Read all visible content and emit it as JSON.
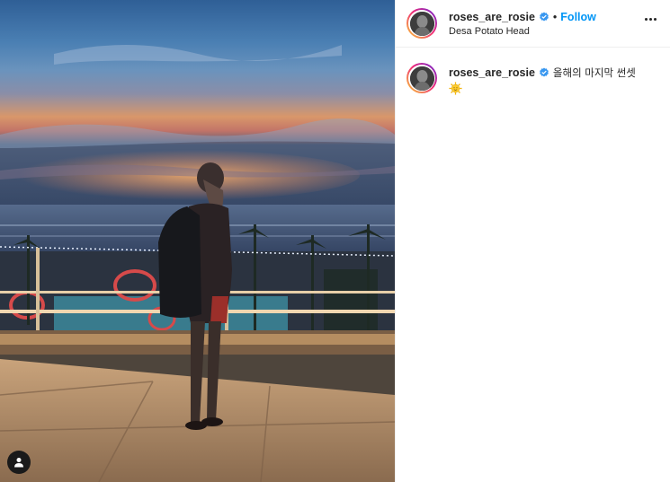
{
  "post": {
    "username": "roses_are_rosie",
    "verified": true,
    "separator": "•",
    "follow_label": "Follow",
    "location": "Desa Potato Head",
    "more_icon": "more-horizontal-icon",
    "caption": {
      "username": "roses_are_rosie",
      "text": "올해의 마지막 썬셋",
      "emoji": "sun-with-face-emoji"
    }
  },
  "photo": {
    "subject": "photo",
    "tag_icon": "user-tag-icon"
  },
  "colors": {
    "accent": "#0095f6",
    "text": "#262626",
    "border": "#efefef",
    "verified": "#3897f0"
  }
}
